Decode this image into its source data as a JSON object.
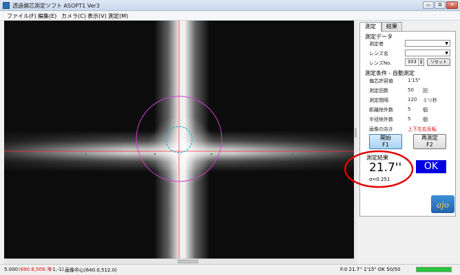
{
  "window": {
    "title": "透過偏芯測定ソフト ASOPT1 Ver3",
    "min_glyph": "▭",
    "max_glyph": "⧉",
    "close_glyph": "✕"
  },
  "menu": {
    "items": [
      "ファイル(F)",
      "編集(E)",
      "カメラ(C)",
      "表示(V)",
      "測定(M)"
    ]
  },
  "viewer": {
    "crosshair_color": "#ff3333",
    "outer_circle_color": "#d040d0",
    "inner_circle_color": "#20b8d8",
    "marker_color": "#1a9a3a"
  },
  "panel": {
    "tabs": [
      "測定",
      "結果"
    ],
    "active_tab": 0,
    "data_section": {
      "header": "測定データ",
      "measurer_label": "測定者",
      "lens_name_label": "レンズ名",
      "lens_no_label": "レンズNo.",
      "lens_no_value": "303",
      "reset_label": "リセット"
    },
    "conditions": {
      "header": "測定条件 - 自動測定",
      "rows": [
        {
          "label": "偏芯許容値",
          "value": "1'15\"",
          "unit": ""
        },
        {
          "label": "測定回数",
          "value": "50",
          "unit": "回"
        },
        {
          "label": "測定間隔",
          "value": "120",
          "unit": "ミリ秒"
        },
        {
          "label": "距離除外数",
          "value": "5",
          "unit": "個"
        },
        {
          "label": "半径除外数",
          "value": "5",
          "unit": "個"
        },
        {
          "label": "画像の向き",
          "value": "上下左右反転",
          "unit": ""
        }
      ]
    },
    "buttons": {
      "start": {
        "label": "開始",
        "key": "F1"
      },
      "remeasure": {
        "label": "再測定",
        "key": "F2"
      }
    },
    "result": {
      "header": "測定結果",
      "value": "21.7''",
      "sigma": "σ=0.251",
      "status": "OK",
      "status_color": "#0000e0"
    },
    "highlight_color": "#e00000"
  },
  "status": {
    "zoom": "5.000",
    "coords": "(690.6,509.7)",
    "offset": "(-1,-1)",
    "center": "画像中心(640.0,512.0)",
    "summary": "F:0  21.7''  1'15\"  OK  50/50",
    "progress": 1.0,
    "progress_color": "#27c53a"
  }
}
